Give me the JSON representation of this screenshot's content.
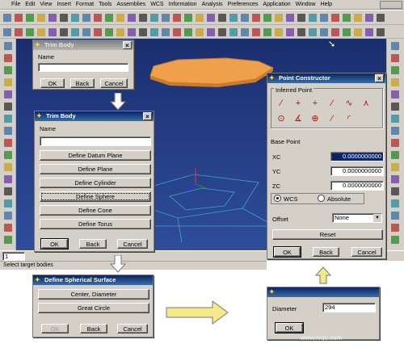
{
  "menu": [
    "File",
    "Edit",
    "View",
    "Insert",
    "Format",
    "Tools",
    "Assemblies",
    "WCS",
    "Information",
    "Analysis",
    "Preferences",
    "Application",
    "Window",
    "Help"
  ],
  "status_bar": "Select target bodies",
  "small_combo": "1",
  "trim_body_small": {
    "title": "Trim Body",
    "name_label": "Name",
    "buttons": [
      "OK",
      "Back",
      "Cancel"
    ]
  },
  "trim_body": {
    "title": "Trim Body",
    "name_label": "Name",
    "options": [
      "Define Datum Plane",
      "Define Plane",
      "Define Cylinder",
      "Define Sphere",
      "Define Cone",
      "Define Torus"
    ],
    "buttons": [
      "OK",
      "Back",
      "Cancel"
    ]
  },
  "point_constructor": {
    "title": "Point Constructor",
    "inferred_point_label": "Inferred Point",
    "base_point_label": "Base Point",
    "coords": [
      {
        "label": "XC",
        "value": "0.0000000000"
      },
      {
        "label": "YC",
        "value": "0.0000000000"
      },
      {
        "label": "ZC",
        "value": "0.0000000000"
      }
    ],
    "radio_wcs": "WCS",
    "radio_absolute": "Absolute",
    "offset_label": "Offset",
    "offset_value": "None",
    "reset_label": "Reset",
    "buttons": [
      "OK",
      "Back",
      "Cancel"
    ]
  },
  "spherical_surface": {
    "title": "Define Spherical Surface",
    "options": [
      "Center, Diameter",
      "Great Circle"
    ],
    "buttons": [
      "OK",
      "Back",
      "Cancel"
    ]
  },
  "diameter_dialog": {
    "label": "Diameter",
    "value": "294",
    "ok_label": "OK"
  },
  "watermark": "www.lvqu.com",
  "colors": {
    "viewport_top": "#1a2e6e",
    "viewport_bottom": "#2f4d9c",
    "part_fill": "#f0a04b",
    "title_active": "#0a246a",
    "callout_arrow": "#f5e98a"
  }
}
